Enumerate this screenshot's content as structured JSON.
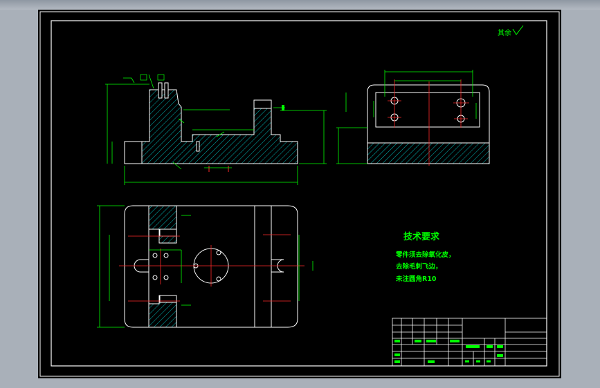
{
  "drawing": {
    "surface_roughness_note": "其余",
    "technical_requirements": {
      "title": "技术要求",
      "items": [
        "零件须去除氧化皮，",
        "去除毛刺飞边，",
        "未注圆角R10"
      ]
    }
  },
  "colors": {
    "canvas": "#000000",
    "frame": "#ffffff",
    "outline": "#ffffff",
    "hatch": "#00b8b8",
    "dimension": "#00ff00",
    "centerline": "#ff2a2a",
    "text": "#00ff00",
    "title_grid": "#ffffff",
    "annotation": "#00ffff"
  }
}
